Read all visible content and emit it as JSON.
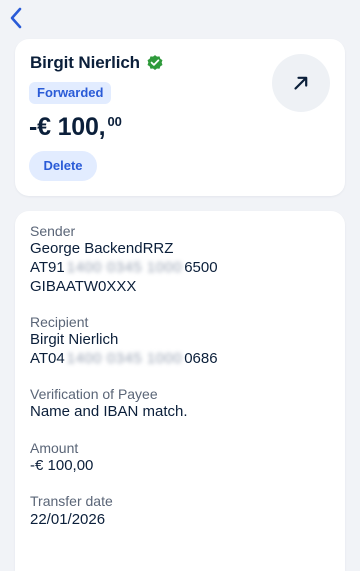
{
  "header": {
    "back_icon": "chevron-left-icon"
  },
  "summary": {
    "recipient_name": "Birgit Nierlich",
    "verified_icon": "verified-check-icon",
    "verified_color": "#2f9a3b",
    "status_badge": "Forwarded",
    "amount_main": "-€ 100,",
    "amount_cents": "00",
    "delete_label": "Delete",
    "arrow_icon": "arrow-up-right-icon"
  },
  "details": {
    "sender_label": "Sender",
    "sender_name": "George BackendRRZ",
    "sender_iban_prefix": "AT91",
    "sender_iban_masked": "1400 0345 1000",
    "sender_iban_suffix": "6500",
    "sender_bic": "GIBAATW0XXX",
    "recipient_label": "Recipient",
    "recipient_name": "Birgit Nierlich",
    "recipient_iban_prefix": "AT04",
    "recipient_iban_masked": "1400 0345 1000",
    "recipient_iban_suffix": "0686",
    "verification_label": "Verification of Payee",
    "verification_value": "Name and IBAN match.",
    "amount_label": "Amount",
    "amount_value": "-€ 100,00",
    "date_label": "Transfer date",
    "date_value": "22/01/2026"
  },
  "colors": {
    "accent": "#2a5bd7",
    "accent_bg": "#e2ecff",
    "text": "#0b1f3a",
    "label": "#5a6577",
    "background": "#f1f3f7"
  }
}
